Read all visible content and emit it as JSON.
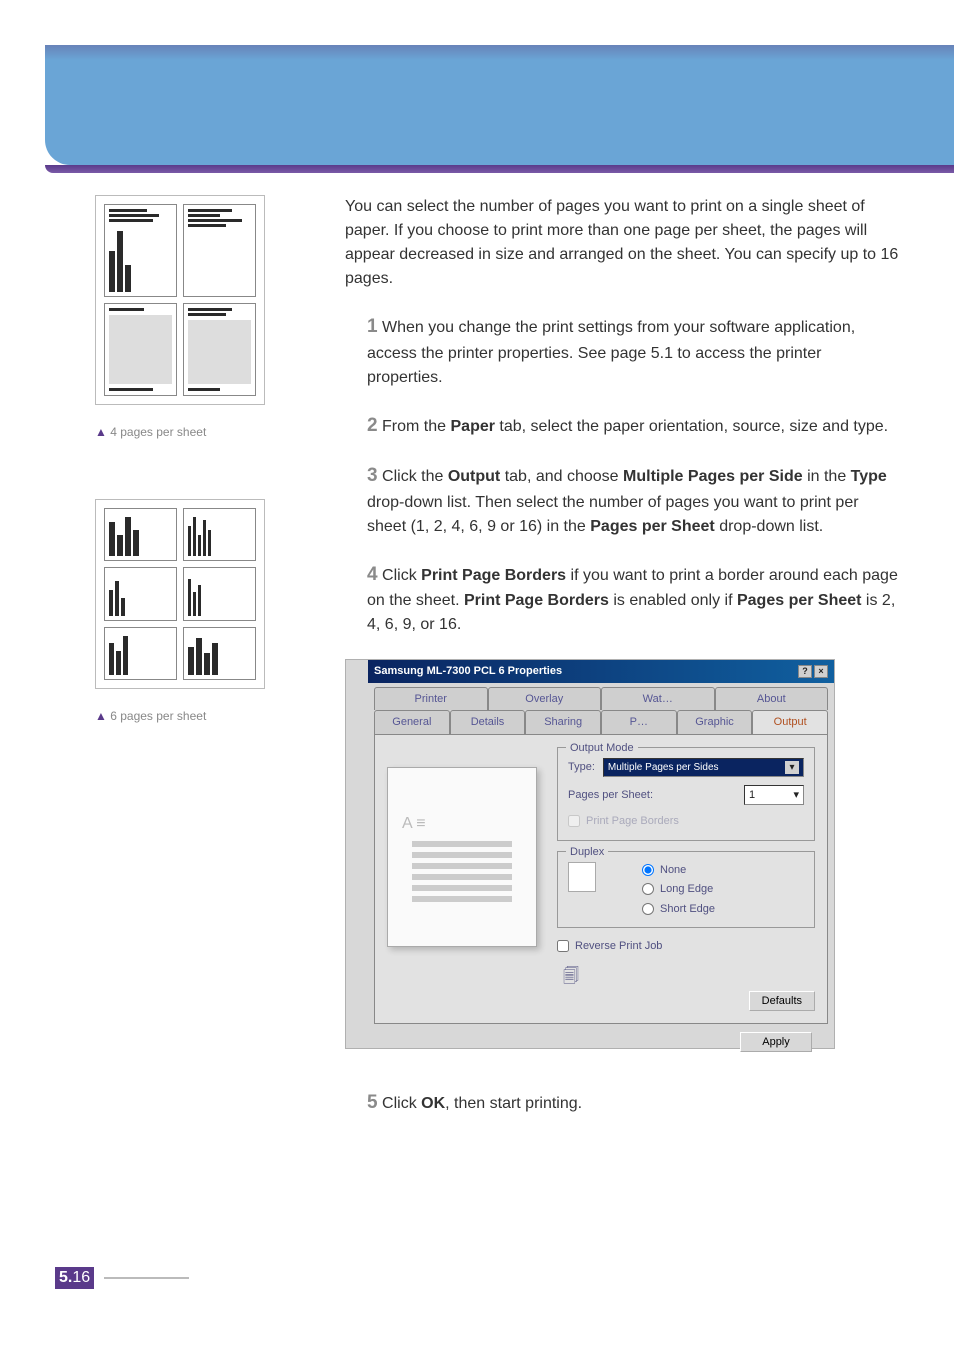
{
  "intro": "You can select the number of pages you want to print on a single sheet of paper. If you choose to print more than one page per sheet, the pages will appear decreased in size and arranged on the sheet. You can specify up to 16 pages.",
  "captions": {
    "four": "4 pages per sheet",
    "six": "6 pages per sheet"
  },
  "step1": {
    "a": "When you change the print settings from your software application, access the printer properties. See page 5.1 to access the printer properties."
  },
  "step2": {
    "a": "From the ",
    "b": "Paper",
    "c": " tab, select the paper orientation, source, size and type."
  },
  "step3": {
    "a": "Click the ",
    "b": "Output",
    "c": " tab, and choose ",
    "d": "Multiple Pages per Side",
    "e": " in the ",
    "f": "Type",
    "g": " drop-down list. Then select the number of pages you want to print per sheet (1, 2, 4, 6, 9 or 16) in the ",
    "h": "Pages per Sheet",
    "i": " drop-down list."
  },
  "step4": {
    "a": "Click ",
    "b": "Print Page Borders",
    "c": " if you want to print a border around each page on the sheet. ",
    "d": "Print Page Borders",
    "e": " is enabled only if ",
    "f": "Pages per Sheet",
    "g": " is 2, 4, 6, 9, or 16."
  },
  "step5": {
    "a": "Click ",
    "b": "OK",
    "c": ", then start printing."
  },
  "dialog": {
    "title": "Samsung ML-7300 PCL 6 Properties",
    "tabs_row1": [
      "Printer",
      "Overlay",
      "Wat…",
      "About"
    ],
    "tabs_row2": [
      "General",
      "Details",
      "Sharing",
      "P…",
      "Graphic",
      "Output"
    ],
    "output_mode": {
      "legend": "Output Mode",
      "type_label": "Type:",
      "type_value": "Multiple Pages per Sides",
      "pps_label": "Pages per Sheet:",
      "pps_value": "1",
      "ppb": "Print Page Borders"
    },
    "duplex": {
      "legend": "Duplex",
      "none": "None",
      "long": "Long Edge",
      "short": "Short Edge"
    },
    "reverse": "Reverse Print Job",
    "defaults": "Defaults",
    "apply": "Apply"
  },
  "pagenum": {
    "chapter": "5.",
    "page": "16"
  }
}
